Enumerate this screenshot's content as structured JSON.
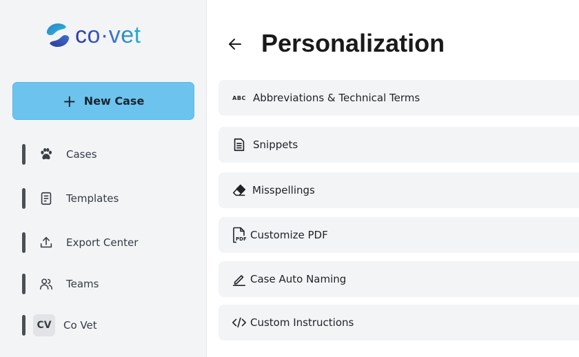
{
  "brand": {
    "name": "co·vet"
  },
  "sidebar": {
    "new_case_label": "New Case",
    "items": [
      {
        "label": "Cases",
        "icon": "paw-icon"
      },
      {
        "label": "Templates",
        "icon": "document-icon"
      },
      {
        "label": "Export Center",
        "icon": "upload-icon"
      },
      {
        "label": "Teams",
        "icon": "users-icon"
      },
      {
        "label": "Co Vet",
        "avatar": "CV"
      }
    ]
  },
  "main": {
    "title": "Personalization",
    "rows": [
      {
        "label": "Abbreviations & Technical Terms",
        "icon": "abc-icon",
        "icon_text": "ABC"
      },
      {
        "label": "Snippets",
        "icon": "document-lines-icon"
      },
      {
        "label": "Misspellings",
        "icon": "eraser-icon"
      },
      {
        "label": "Customize PDF",
        "icon": "pdf-file-icon",
        "icon_text": "PDF"
      },
      {
        "label": "Case Auto Naming",
        "icon": "pencil-icon"
      },
      {
        "label": "Custom Instructions",
        "icon": "code-icon"
      }
    ]
  },
  "colors": {
    "accent": "#6cc4ee",
    "sidebar_bg": "#f3f4f6",
    "row_bg": "#f3f4f6",
    "logo_gradient": [
      "#2e3c9e",
      "#27b3c9"
    ]
  }
}
